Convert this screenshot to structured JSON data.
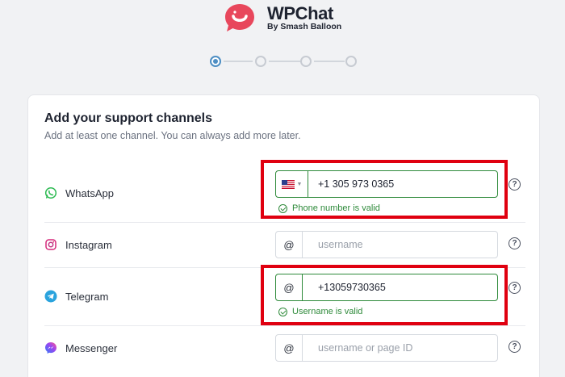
{
  "brand": {
    "name": "WPChat",
    "subtitle": "By Smash Balloon",
    "accent": "#e8475c"
  },
  "stepper": {
    "total_steps": 4,
    "current_step": 1
  },
  "card": {
    "title": "Add your support channels",
    "subtitle": "Add at least one channel. You can always add more later."
  },
  "channels": [
    {
      "name": "WhatsApp",
      "icon": "whatsapp-icon",
      "prefix": "flag-us",
      "value": "+1 305 973 0365",
      "placeholder": "",
      "validation": "Phone number is valid",
      "help": "?"
    },
    {
      "name": "Instagram",
      "icon": "instagram-icon",
      "prefix": "@",
      "value": "",
      "placeholder": "username",
      "validation": "",
      "help": "?"
    },
    {
      "name": "Telegram",
      "icon": "telegram-icon",
      "prefix": "@",
      "value": "+13059730365",
      "placeholder": "",
      "validation": "Username is valid",
      "help": "?"
    },
    {
      "name": "Messenger",
      "icon": "messenger-icon",
      "prefix": "@",
      "value": "",
      "placeholder": "username or page ID",
      "validation": "",
      "help": "?"
    }
  ],
  "colors": {
    "valid": "#2e8a3a",
    "highlight": "#e00010",
    "step_active": "#4d8ec3"
  }
}
